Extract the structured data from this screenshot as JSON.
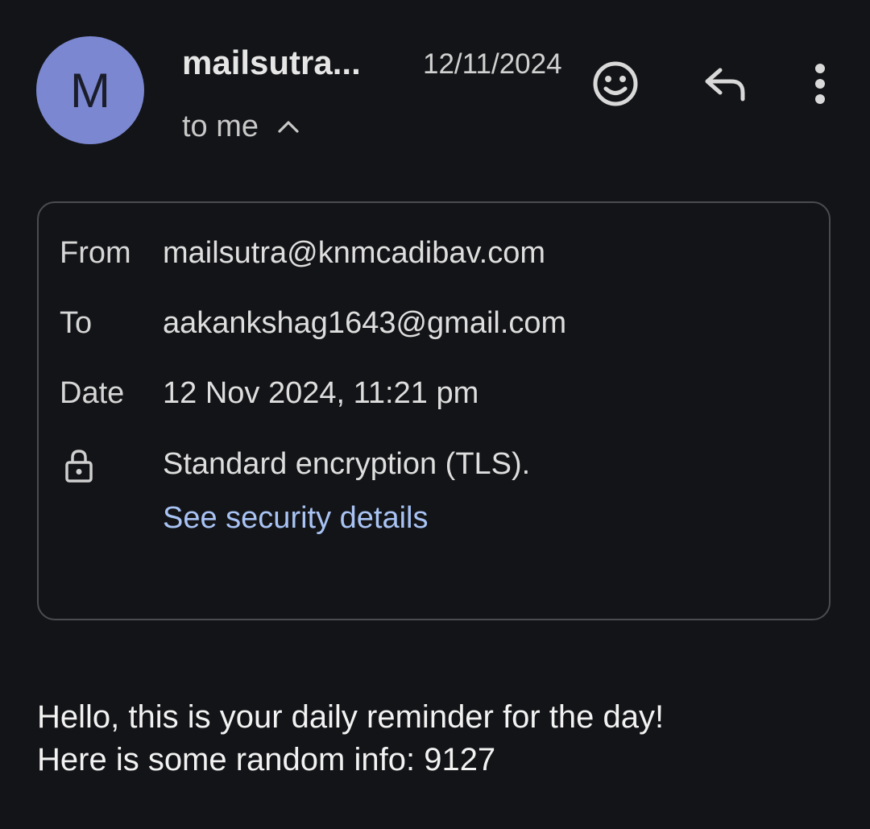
{
  "header": {
    "avatar_letter": "M",
    "avatar_color": "#7b88d1",
    "sender_name": "mailsutra...",
    "date_short": "12/11/2024",
    "recipient_summary": "to me",
    "actions": {
      "emoji_icon": "smiley-face-icon",
      "reply_icon": "reply-arrow-icon",
      "more_icon": "more-vertical-icon"
    }
  },
  "details": {
    "from_label": "From",
    "from_value": "mailsutra@knmcadibav.com",
    "to_label": "To",
    "to_value": "aakankshag1643@gmail.com",
    "date_label": "Date",
    "date_value": "12 Nov 2024, 11:21 pm",
    "encryption_icon": "lock-icon",
    "encryption_text": "Standard encryption (TLS).",
    "security_link": "See security details",
    "link_color": "#a8c3f4"
  },
  "message": {
    "line1": "Hello, this is your daily reminder for the day!",
    "line2": "Here is some random info: 9127"
  }
}
